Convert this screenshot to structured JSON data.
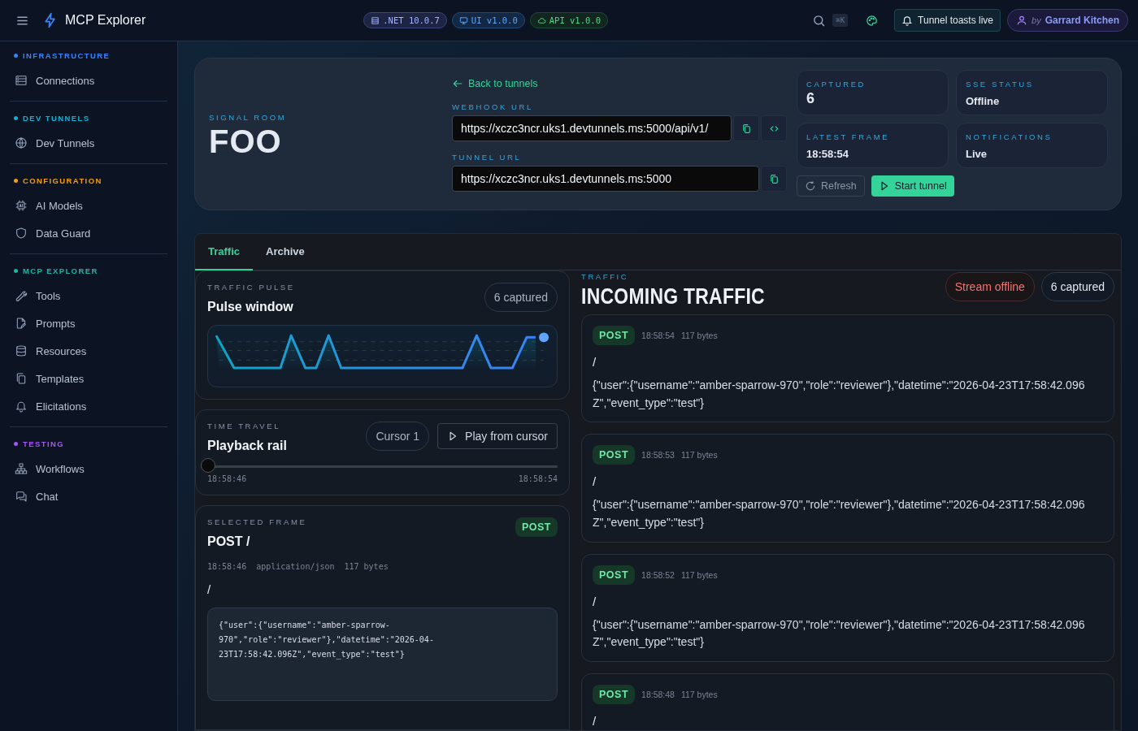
{
  "topbar": {
    "app_title": "MCP Explorer",
    "badges": [
      {
        "kind": "server",
        "text": ".NET 10.0.7"
      },
      {
        "kind": "ui",
        "text": "UI v1.0.0"
      },
      {
        "kind": "api",
        "text": "API v1.0.0"
      }
    ],
    "shortcut": "⌘K",
    "notification_button": "Tunnel toasts live",
    "user": {
      "prefix": "by",
      "name": "Garrard Kitchen"
    }
  },
  "sidebar": {
    "sections": [
      {
        "title": "INFRASTRUCTURE",
        "color": "#3b82f6",
        "items": [
          {
            "label": "Connections",
            "kind": "server"
          }
        ]
      },
      {
        "title": "DEV TUNNELS",
        "color": "#06b6d4",
        "items": [
          {
            "label": "Dev Tunnels",
            "kind": "globe"
          }
        ]
      },
      {
        "title": "CONFIGURATION",
        "color": "#f59e0b",
        "items": [
          {
            "label": "AI Models",
            "kind": "chip"
          },
          {
            "label": "Data Guard",
            "kind": "shield"
          }
        ]
      },
      {
        "title": "MCP EXPLORER",
        "color": "#14b8a6",
        "items": [
          {
            "label": "Tools",
            "kind": "wrench"
          },
          {
            "label": "Prompts",
            "kind": "file"
          },
          {
            "label": "Resources",
            "kind": "database"
          },
          {
            "label": "Templates",
            "kind": "copy"
          },
          {
            "label": "Elicitations",
            "kind": "bell"
          }
        ]
      },
      {
        "title": "TESTING",
        "color": "#a855f7",
        "items": [
          {
            "label": "Workflows",
            "kind": "hierarchy"
          },
          {
            "label": "Chat",
            "kind": "chat"
          }
        ]
      }
    ]
  },
  "hero": {
    "eyebrow": "SIGNAL ROOM",
    "title": "FOO",
    "back_link": "Back to tunnels",
    "webhook": {
      "label": "WEBHOOK URL",
      "value": "https://xczc3ncr.uks1.devtunnels.ms:5000/api/v1/"
    },
    "tunnel": {
      "label": "TUNNEL URL",
      "value": "https://xczc3ncr.uks1.devtunnels.ms:5000"
    },
    "stats": [
      {
        "label": "CAPTURED",
        "value": "6",
        "kind": "large"
      },
      {
        "label": "SSE STATUS",
        "value": "Offline",
        "kind": "normal"
      },
      {
        "label": "LATEST FRAME",
        "value": "18:58:54",
        "kind": "normal"
      },
      {
        "label": "NOTIFICATIONS",
        "value": "Live",
        "kind": "normal"
      }
    ],
    "refresh_button": "Refresh",
    "start_button": "Start tunnel"
  },
  "tabs": [
    {
      "label": "Traffic",
      "selected": true
    },
    {
      "label": "Archive",
      "selected": false
    }
  ],
  "pulse": {
    "eyebrow": "TRAFFIC PULSE",
    "title": "Pulse window",
    "count": "6 captured"
  },
  "time_travel": {
    "eyebrow": "TIME TRAVEL",
    "title": "Playback rail",
    "cursor": "Cursor 1",
    "play_button": "Play from cursor",
    "level": 0,
    "start": "18:58:46",
    "end": "18:58:54"
  },
  "selected_frame": {
    "eyebrow": "SELECTED FRAME",
    "title": "POST /",
    "method": "POST",
    "time": "18:58:46",
    "content_type": "application/json",
    "size": "117 bytes",
    "path": "/",
    "body": "{\"user\":{\"username\":\"amber-sparrow-970\",\"role\":\"reviewer\"},\"datetime\":\"2026-04-23T17:58:42.096Z\",\"event_type\":\"test\"}"
  },
  "traffic": {
    "eyebrow": "TRAFFIC",
    "title": "INCOMING TRAFFIC",
    "status": "Stream offline",
    "count": "6 captured",
    "events": [
      {
        "method": "POST",
        "time": "18:58:54",
        "size": "117 bytes",
        "path": "/",
        "body": "{\"user\":{\"username\":\"amber-sparrow-970\",\"role\":\"reviewer\"},\"datetime\":\"2026-04-23T17:58:42.096Z\",\"event_type\":\"test\"}"
      },
      {
        "method": "POST",
        "time": "18:58:53",
        "size": "117 bytes",
        "path": "/",
        "body": "{\"user\":{\"username\":\"amber-sparrow-970\",\"role\":\"reviewer\"},\"datetime\":\"2026-04-23T17:58:42.096Z\",\"event_type\":\"test\"}"
      },
      {
        "method": "POST",
        "time": "18:58:52",
        "size": "117 bytes",
        "path": "/",
        "body": "{\"user\":{\"username\":\"amber-sparrow-970\",\"role\":\"reviewer\"},\"datetime\":\"2026-04-23T17:58:42.096Z\",\"event_type\":\"test\"}"
      },
      {
        "method": "POST",
        "time": "18:58:48",
        "size": "117 bytes",
        "path": "/"
      }
    ]
  }
}
